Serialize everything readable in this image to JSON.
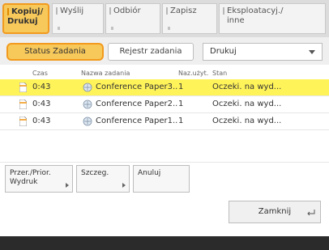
{
  "tabs": [
    {
      "line1": "Kopiuj/",
      "line2": "Drukuj"
    },
    {
      "line1": "Wyślij",
      "line2": ""
    },
    {
      "line1": "Odbiór",
      "line2": ""
    },
    {
      "line1": "Zapisz",
      "line2": ""
    },
    {
      "line1": "Eksploatacyj./",
      "line2": "inne"
    }
  ],
  "subtabs": {
    "status": "Status Zadania",
    "log": "Rejestr zadania"
  },
  "filter": {
    "selected": "Drukuj"
  },
  "table": {
    "headers": {
      "time": "Czas",
      "name": "Nazwa zadania",
      "user": "Naz.użyt.",
      "state": "Stan"
    },
    "rows": [
      {
        "time": "0:43",
        "name": "Conference Paper3..",
        "user": "1",
        "state": "Oczeki. na wyd..."
      },
      {
        "time": "0:43",
        "name": "Conference Paper2..",
        "user": "1",
        "state": "Oczeki. na wyd..."
      },
      {
        "time": "0:43",
        "name": "Conference Paper1..",
        "user": "1",
        "state": "Oczeki. na wyd..."
      }
    ]
  },
  "actions": {
    "priority_line1": "Przer./Prior.",
    "priority_line2": "Wydruk",
    "details": "Szczeg.",
    "cancel": "Anuluj"
  },
  "close": "Zamknij",
  "colors": {
    "accent": "#f29a1d",
    "selection": "#fff35a"
  }
}
